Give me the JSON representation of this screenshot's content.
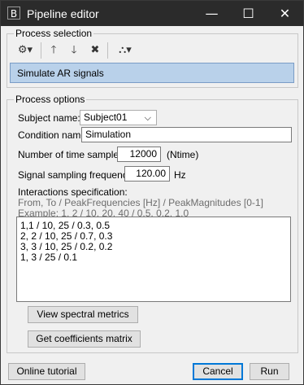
{
  "window": {
    "title": "Pipeline editor",
    "icon_text": "B",
    "controls": {
      "minimize": "—",
      "maximize": "☐",
      "close": "✕"
    }
  },
  "process_selection": {
    "label": "Process selection",
    "toolbar": {
      "gear": "⚙▾",
      "up": "🡑",
      "down": "🡓",
      "delete": "✖",
      "pipeline": "⛬▾"
    },
    "selected_process": "Simulate AR signals"
  },
  "process_options": {
    "label": "Process options",
    "subject_label": "Subject name:",
    "subject_value": "Subject01",
    "condition_label": "Condition name:",
    "condition_value": "Simulation",
    "samples_label": "Number of time samples:",
    "samples_value": "12000",
    "samples_unit": "(Ntime)",
    "freq_label": "Signal sampling frequency:",
    "freq_value": "120.00",
    "freq_unit": "Hz",
    "interactions_label": "Interactions specification:",
    "help_line1": "From, To  /  PeakFrequencies [Hz]  /  PeakMagnitudes [0-1]",
    "help_line2": "Example:  1, 2  /  10, 20, 40  /  0.5, 0.2, 1.0",
    "interactions_lines": [
      "1,1 / 10, 25 / 0.3, 0.5",
      "2, 2 / 10, 25 / 0.7, 0.3",
      "3, 3 / 10, 25 / 0.2, 0.2",
      "1, 3 / 25 / 0.1"
    ],
    "btn_spectral": "View spectral metrics",
    "btn_coeffs": "Get coefficients matrix"
  },
  "footer": {
    "tutorial": "Online tutorial",
    "cancel": "Cancel",
    "run": "Run"
  }
}
